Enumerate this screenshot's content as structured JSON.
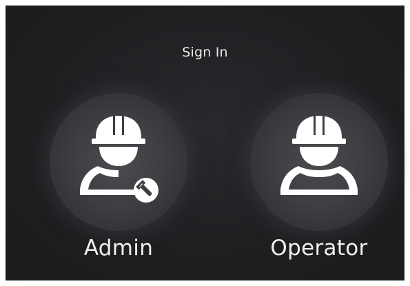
{
  "dialog": {
    "title": "Sign In"
  },
  "roles": [
    {
      "label": "Admin",
      "icon": "admin-worker-wrench-icon"
    },
    {
      "label": "Operator",
      "icon": "operator-worker-icon"
    }
  ],
  "colors": {
    "background": "#1e1f21",
    "circle": "#3e3f43",
    "icon": "#ffffff",
    "text": "#f0f0f0"
  }
}
